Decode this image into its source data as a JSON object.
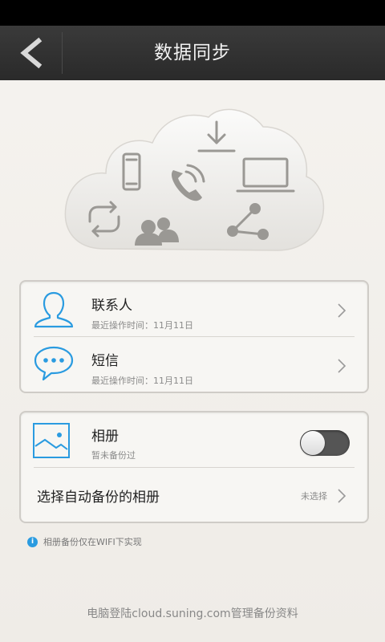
{
  "header": {
    "title": "数据同步"
  },
  "sync_items": [
    {
      "name": "联系人",
      "status": "最近操作时间：11月11日",
      "icon": "contact-person-icon"
    },
    {
      "name": "短信",
      "status": "最近操作时间：11月11日",
      "icon": "chat-bubble-icon"
    }
  ],
  "album": {
    "name": "相册",
    "status": "暂未备份过",
    "toggle_on": false,
    "select_label": "选择自动备份的相册",
    "select_value": "未选择"
  },
  "note": "相册备份仅在WIFI下实现",
  "footer": "电脑登陆cloud.suning.com管理备份资料",
  "colors": {
    "accent": "#2a9be0",
    "titlebar": "#333333",
    "toggle_off": "#555555"
  }
}
